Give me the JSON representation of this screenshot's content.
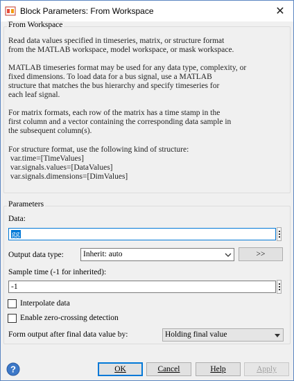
{
  "window": {
    "title": "Block Parameters: From Workspace",
    "close_glyph": "✕"
  },
  "description": {
    "legend": "From Workspace",
    "lines": [
      "Read data values specified in timeseries, matrix, or structure format",
      "from the MATLAB workspace, model workspace, or mask workspace.",
      "",
      "MATLAB timeseries format may be used for any data type, complexity, or",
      "fixed dimensions. To load data for a bus signal, use a MATLAB",
      "structure that matches the bus hierarchy and specify timeseries for",
      "each leaf signal.",
      "",
      "For matrix formats, each row of the matrix has a time stamp in the",
      "first column and a vector containing the corresponding data sample in",
      "the subsequent column(s).",
      "",
      "For structure format, use the following kind of structure:",
      " var.time=[TimeValues]",
      " var.signals.values=[DataValues]",
      " var.signals.dimensions=[DimValues]"
    ]
  },
  "parameters": {
    "legend": "Parameters",
    "data_label": "Data:",
    "data_value": "gg",
    "output_type_label": "Output data type:",
    "output_type_value": "Inherit: auto",
    "output_type_button": ">>",
    "sample_time_label": "Sample time (-1 for inherited):",
    "sample_time_value": "-1",
    "interpolate_label": "Interpolate data",
    "interpolate_checked": false,
    "zero_crossing_label": "Enable zero-crossing detection",
    "zero_crossing_checked": false,
    "form_output_label": "Form output after final data value by:",
    "form_output_value": "Holding final value"
  },
  "footer": {
    "ok_label": "OK",
    "cancel_label": "Cancel",
    "help_label": "Help",
    "apply_label": "Apply"
  },
  "colors": {
    "window_bg": "#f0f0f0",
    "selection": "#0078d7",
    "default_button_border": "#0078d7",
    "help_icon": "#3c78c8"
  }
}
